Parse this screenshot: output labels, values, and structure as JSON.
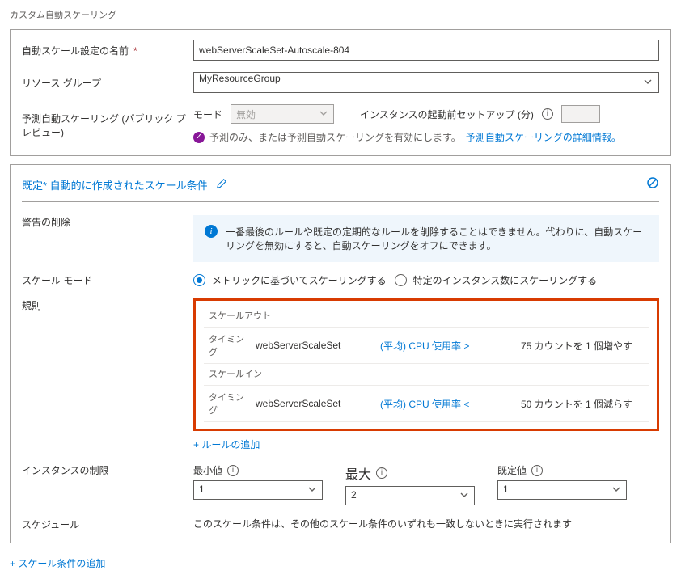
{
  "page_title": "カスタム自動スケーリング",
  "settings": {
    "name_label": "自動スケール設定の名前",
    "name_value": "webServerScaleSet-Autoscale-804",
    "rg_label": "リソース グループ",
    "rg_value": "MyResourceGroup",
    "pred_label": "予測自動スケーリング (パブリック プレビュー)",
    "mode_label": "モード",
    "mode_value": "無効",
    "setup_label": "インスタンスの起動前セットアップ (分)",
    "pred_warning_prefix": "予測のみ、または予測自動スケーリングを有効にします。",
    "pred_warning_link": "予測自動スケーリングの詳細情報。"
  },
  "condition": {
    "title": "既定* 自動的に作成されたスケール条件",
    "delete_warning_label": "警告の削除",
    "delete_warning_text": "一番最後のルールや既定の定期的なルールを削除することはできません。代わりに、自動スケーリングを無効にすると、自動スケーリングをオフにできます。",
    "scale_mode_label": "スケール モード",
    "radio_metric": "メトリックに基づいてスケーリングする",
    "radio_fixed": "特定のインスタンス数にスケーリングする",
    "rules_label": "規則",
    "scale_out_label": "スケールアウト",
    "scale_in_label": "スケールイン",
    "timing_label": "タイミング",
    "rule_out": {
      "target": "webServerScaleSet",
      "metric": "(平均) CPU 使用率 >",
      "cond": "75 カウントを 1 個増やす"
    },
    "rule_in": {
      "target": "webServerScaleSet",
      "metric": "(平均) CPU 使用率 <",
      "cond": "50 カウントを 1 個減らす"
    },
    "add_rule": "ルールの追加",
    "limits_label": "インスタンスの制限",
    "min_label": "最小値",
    "max_label": "最大",
    "default_label": "既定値",
    "min_value": "1",
    "max_value": "2",
    "default_value": "1",
    "schedule_label": "スケジュール",
    "schedule_text": "このスケール条件は、その他のスケール条件のいずれも一致しないときに実行されます"
  },
  "add_condition": "スケール条件の追加"
}
